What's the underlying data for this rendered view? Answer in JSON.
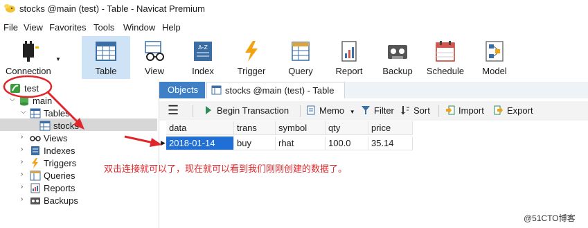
{
  "window": {
    "title": "stocks @main (test) - Table - Navicat Premium"
  },
  "menu": [
    "File",
    "View",
    "Favorites",
    "Tools",
    "Window",
    "Help"
  ],
  "toolbar": {
    "connection": "Connection",
    "table": "Table",
    "view": "View",
    "index": "Index",
    "trigger": "Trigger",
    "query": "Query",
    "report": "Report",
    "backup": "Backup",
    "schedule": "Schedule",
    "model": "Model"
  },
  "tree": {
    "connection": "test",
    "database": "main",
    "tables": "Tables",
    "table_item": "stocks",
    "views": "Views",
    "indexes": "Indexes",
    "triggers": "Triggers",
    "queries": "Queries",
    "reports": "Reports",
    "backups": "Backups"
  },
  "tabs": {
    "objects": "Objects",
    "document": "stocks @main (test) - Table"
  },
  "subtoolbar": {
    "begin_transaction": "Begin Transaction",
    "memo": "Memo",
    "filter": "Filter",
    "sort": "Sort",
    "import": "Import",
    "export": "Export"
  },
  "table": {
    "columns": [
      "data",
      "trans",
      "symbol",
      "qty",
      "price"
    ],
    "rows": [
      [
        "2018-01-14",
        "buy",
        "rhat",
        "100.0",
        "35.14"
      ]
    ]
  },
  "annotation": "双击连接就可以了，现在就可以看到我们刚刚创建的数据了。",
  "watermark": "@51CTO博客",
  "colors": {
    "accent": "#3f7fc6",
    "selection": "#1f6fd6",
    "annotation": "#e0262b",
    "toolbar_active": "#cfe3f7"
  }
}
